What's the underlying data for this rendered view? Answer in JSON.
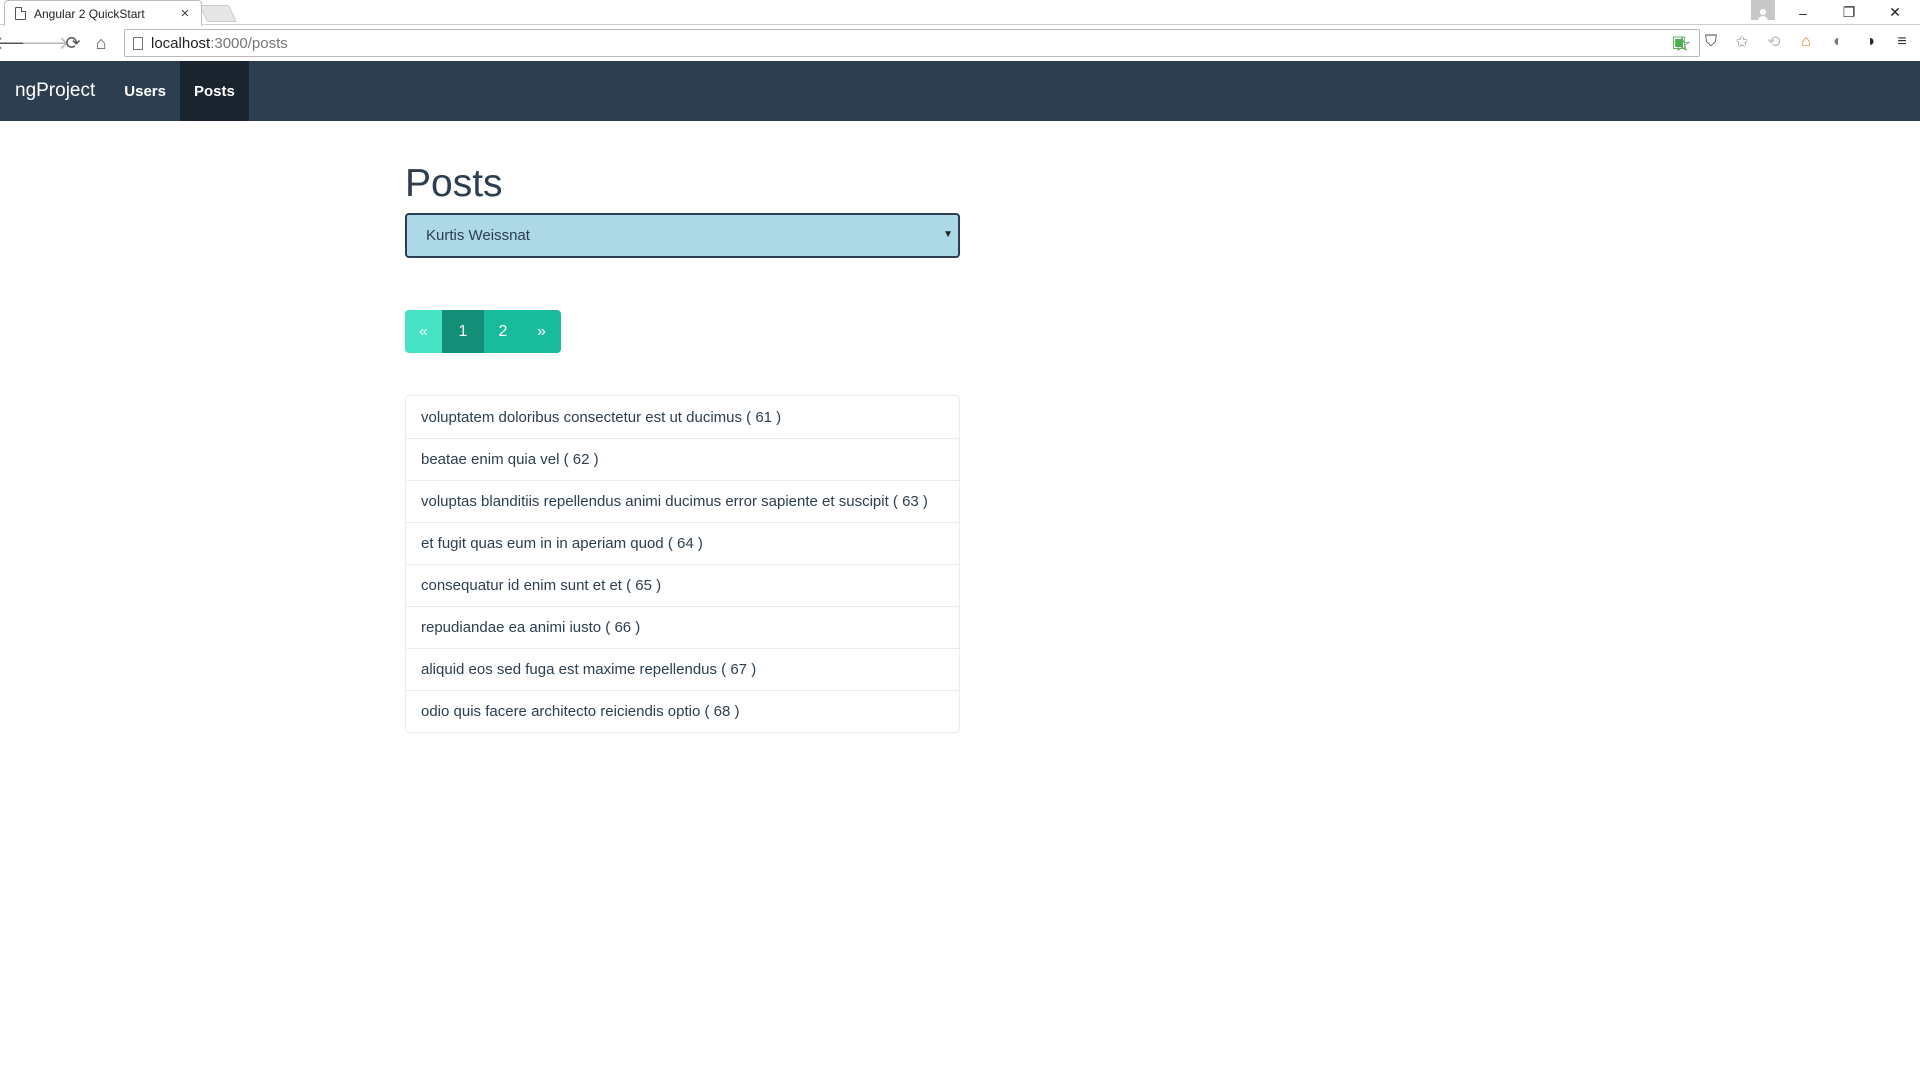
{
  "browser": {
    "tab_title": "Angular 2 QuickStart",
    "tab_close": "×",
    "url_host": "localhost",
    "url_path": ":3000/posts",
    "window_controls": {
      "minimize": "–",
      "restore": "❐",
      "close": "✕"
    }
  },
  "navbar": {
    "brand": "ngProject",
    "links": [
      {
        "label": "Users",
        "active": false
      },
      {
        "label": "Posts",
        "active": true
      }
    ]
  },
  "main": {
    "title": "Posts",
    "user_select": {
      "selected": "Kurtis Weissnat"
    },
    "pagination": {
      "prev": "«",
      "pages": [
        "1",
        "2"
      ],
      "active_page": "1",
      "next": "»"
    },
    "posts": [
      "voluptatem doloribus consectetur est ut ducimus ( 61 )",
      "beatae enim quia vel ( 62 )",
      "voluptas blanditiis repellendus animi ducimus error sapiente et suscipit ( 63 )",
      "et fugit quas eum in in aperiam quod ( 64 )",
      "consequatur id enim sunt et et ( 65 )",
      "repudiandae ea animi iusto ( 66 )",
      "aliquid eos sed fuga est maxime repellendus ( 67 )",
      "odio quis facere architecto reiciendis optio ( 68 )"
    ]
  },
  "colors": {
    "navbar": "#2c3e50",
    "navbar_active": "#1a242f",
    "select_bg": "#add8e6",
    "pagination": "#18bc9c",
    "pagination_active": "#128f76",
    "pagination_prev": "#45e3c4"
  }
}
